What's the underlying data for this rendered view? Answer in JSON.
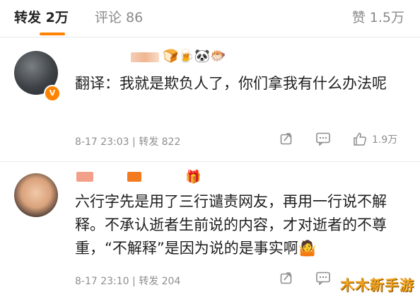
{
  "tabs": {
    "forward": "转发 2万",
    "comment": "评论 86",
    "like": "赞 1.5万"
  },
  "comments": [
    {
      "text": "翻译：我就是欺负人了，你们拿我有什么办法呢",
      "timestamp": "8-17 23:03",
      "forward": "转发 822",
      "like_count": "1.9万",
      "username_emoji": "🍞🍺🐼🐡",
      "verified_badge": "V"
    },
    {
      "text": "六行字先是用了三行谴责网友，再用一行说不解释。不承认逝者生前说的内容，才对逝者的不尊重，“不解释”是因为说的是事实啊🤷",
      "timestamp": "8-17 23:10",
      "forward": "转发 204",
      "username_emoji": "🎁",
      "avatar_caption": "咦惹"
    }
  ],
  "watermark": "木木新手游",
  "icons": {
    "share": "share-icon",
    "comment": "comment-icon",
    "like": "thumbs-up-icon"
  },
  "colors": {
    "accent": "#ff8200",
    "muted": "#8e8e8e"
  }
}
